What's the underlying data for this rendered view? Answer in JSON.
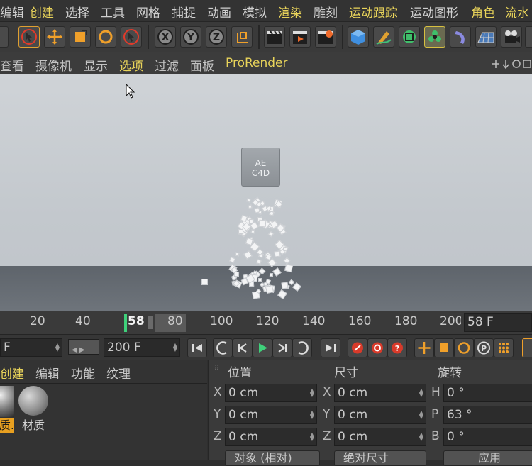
{
  "menubar": {
    "items": [
      "编辑",
      "创建",
      "选择",
      "工具",
      "网格",
      "捕捉",
      "动画",
      "模拟",
      "渲染",
      "雕刻",
      "运动跟踪",
      "运动图形",
      "角色",
      "流水"
    ]
  },
  "viewport_menu": {
    "items": [
      "查看",
      "摄像机",
      "显示",
      "选项",
      "过滤",
      "面板",
      "ProRender"
    ]
  },
  "viewport": {
    "logo_line1": "AE",
    "logo_line2": "C4D"
  },
  "timeline": {
    "ticks": [
      "20",
      "40",
      "58",
      "80",
      "100",
      "120",
      "140",
      "160",
      "180",
      "200"
    ],
    "current_frame": 58,
    "frame_field": "58 F"
  },
  "transport": {
    "start_field": "F",
    "end_field": "200 F"
  },
  "material_panel": {
    "menu": [
      "创建",
      "编辑",
      "功能",
      "纹理"
    ],
    "materials": [
      "质.",
      "材质"
    ]
  },
  "coord_panel": {
    "headers": [
      "位置",
      "尺寸",
      "旋转"
    ],
    "position": [
      {
        "axis": "X",
        "value": "0 cm"
      },
      {
        "axis": "Y",
        "value": "0 cm"
      },
      {
        "axis": "Z",
        "value": "0 cm"
      }
    ],
    "size": [
      {
        "axis": "X",
        "value": "0 cm"
      },
      {
        "axis": "Y",
        "value": "0 cm"
      },
      {
        "axis": "Z",
        "value": "0 cm"
      }
    ],
    "rotation": [
      {
        "axis": "H",
        "value": "0 °"
      },
      {
        "axis": "P",
        "value": "63 °"
      },
      {
        "axis": "B",
        "value": "0 °"
      }
    ],
    "mode_dropdown": "对象 (相对)",
    "size_dropdown": "绝对尺寸",
    "apply_button": "应用"
  },
  "colors": {
    "highlight_yellow": "#e8d35a",
    "accent_orange": "#f0a02a",
    "timeline_marker": "#3fd07a"
  }
}
